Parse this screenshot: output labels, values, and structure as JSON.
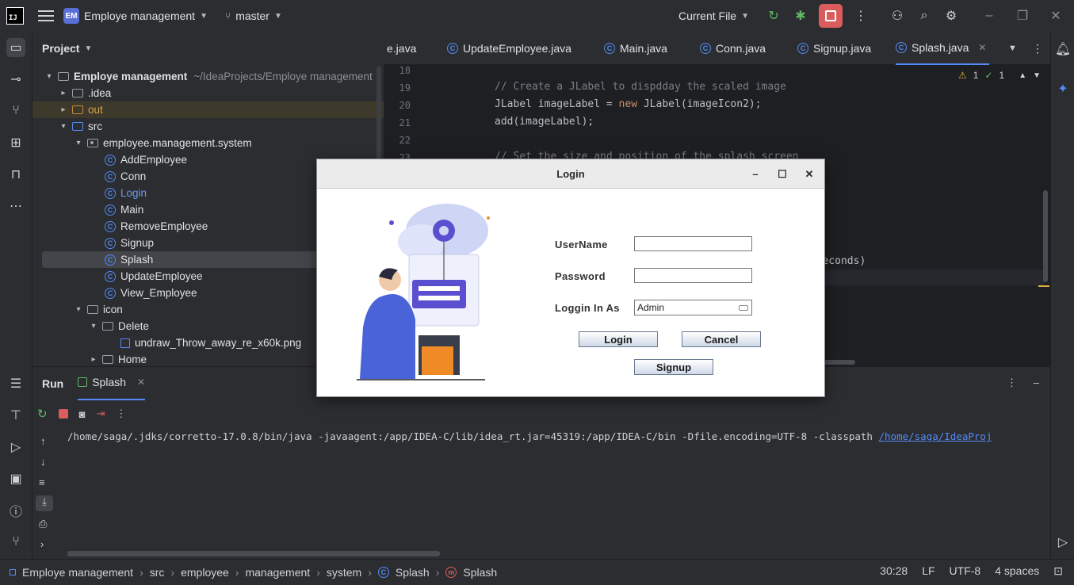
{
  "titlebar": {
    "logo": "IJ",
    "project_badge": "EM",
    "project_name": "Employe management",
    "branch": "master",
    "run_config": "Current File"
  },
  "project_panel": {
    "title": "Project",
    "tree": [
      {
        "label": "Employe management",
        "path": "~/IdeaProjects/Employe management"
      },
      {
        "label": ".idea"
      },
      {
        "label": "out"
      },
      {
        "label": "src"
      },
      {
        "label": "employee.management.system"
      },
      {
        "label": "AddEmployee"
      },
      {
        "label": "Conn"
      },
      {
        "label": "Login"
      },
      {
        "label": "Main"
      },
      {
        "label": "RemoveEmployee"
      },
      {
        "label": "Signup"
      },
      {
        "label": "Splash"
      },
      {
        "label": "UpdateEmployee"
      },
      {
        "label": "View_Employee"
      },
      {
        "label": "icon"
      },
      {
        "label": "Delete"
      },
      {
        "label": "undraw_Throw_away_re_x60k.png"
      },
      {
        "label": "Home"
      }
    ]
  },
  "editor": {
    "tabs": [
      "e.java",
      "UpdateEmployee.java",
      "Main.java",
      "Conn.java",
      "Signup.java",
      "Splash.java"
    ],
    "active_tab": "Splash.java",
    "line_numbers": [
      "18",
      "19",
      "20",
      "21",
      "22",
      "23"
    ],
    "lines": {
      "l19": "// Create a JLabel to dispdday the scaled image",
      "l20a": "JLabel imageLabel = ",
      "l20kw": "new",
      "l20b": " JLabel(imageIcon2);",
      "l21": "add(imageLabel);",
      "l23": "// Set the size and position of the splash screen",
      "tail": "liseconds)"
    },
    "warnings": "1",
    "checks": "1"
  },
  "run_panel": {
    "title": "Run",
    "tab": "Splash",
    "command": "/home/saga/.jdks/corretto-17.0.8/bin/java -javaagent:/app/IDEA-C/lib/idea_rt.jar=45319:/app/IDEA-C/bin -Dfile.encoding=UTF-8 -classpath ",
    "command_link": "/home/saga/IdeaProj"
  },
  "statusbar": {
    "crumbs": [
      "Employe management",
      "src",
      "employee",
      "management",
      "system",
      "Splash",
      "Splash"
    ],
    "position": "30:28",
    "line_sep": "LF",
    "encoding": "UTF-8",
    "indent": "4 spaces"
  },
  "dialog": {
    "title": "Login",
    "username_label": "UserName",
    "username_value": "",
    "password_label": "Password",
    "password_value": "",
    "role_label": "Loggin In As",
    "role_value": "Admin",
    "login_button": "Login",
    "cancel_button": "Cancel",
    "signup_button": "Signup"
  },
  "colors": {
    "accent": "#548af7",
    "stop": "#db5c5c",
    "illustration_primary": "#5a4fcf",
    "illustration_orange": "#f08a24"
  }
}
